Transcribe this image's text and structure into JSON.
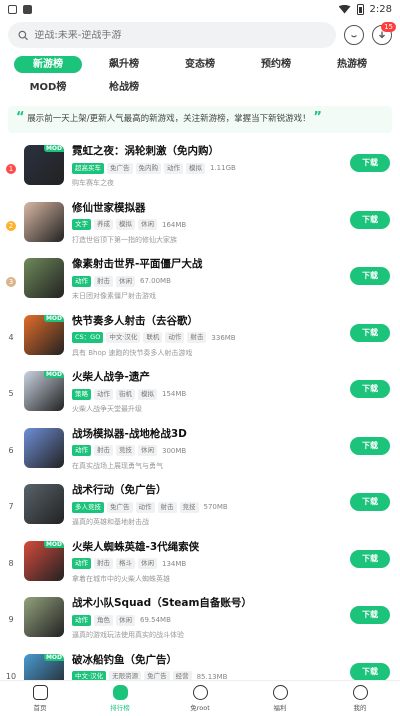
{
  "status": {
    "time": "2:28"
  },
  "search": {
    "placeholder": "逆战:未来-逆战手游",
    "mail_badge": "15"
  },
  "tabs": [
    {
      "label": "新游榜"
    },
    {
      "label": "飙升榜"
    },
    {
      "label": "变态榜"
    },
    {
      "label": "预约榜"
    },
    {
      "label": "热游榜"
    },
    {
      "label": "MOD榜"
    },
    {
      "label": "枪战榜"
    }
  ],
  "notice": {
    "text": "展示前一天上架/更新人气最高的新游戏，关注新游榜，掌握当下新锐游戏！"
  },
  "download_label": "下载",
  "games": [
    {
      "rank": "1",
      "title": "霓虹之夜：涡轮刺激（免内购）",
      "tags": [
        "超高买车",
        "免广告",
        "免内购",
        "动作",
        "模拟"
      ],
      "size": "1.11GB",
      "desc": "购车赛车之夜",
      "mod": true
    },
    {
      "rank": "2",
      "title": "修仙世家模拟器",
      "tags": [
        "文字",
        "养成",
        "模拟",
        "休闲"
      ],
      "size": "164MB",
      "desc": "打造世俗顶下第一指的修仙大家族",
      "mod": false
    },
    {
      "rank": "3",
      "title": "像素射击世界-平面僵尸大战",
      "tags": [
        "动作",
        "射击",
        "休闲"
      ],
      "size": "67.00MB",
      "desc": "末日团对像素僵尸射击游戏",
      "mod": false
    },
    {
      "rank": "4",
      "title": "快节奏多人射击（去谷歌）",
      "tags": [
        "CS：GO",
        "中文·汉化",
        "联机",
        "动作",
        "射击"
      ],
      "size": "336MB",
      "desc": "具有 Bhop 速跑的快节奏多人射击游戏",
      "mod": true
    },
    {
      "rank": "5",
      "title": "火柴人战争-遗产",
      "tags": [
        "策略",
        "动作",
        "街机",
        "模拟"
      ],
      "size": "154MB",
      "desc": "火柴人战争天堂最升级",
      "mod": true
    },
    {
      "rank": "6",
      "title": "战场模拟器-战地枪战3D",
      "tags": [
        "动作",
        "射击",
        "竞技",
        "休闲"
      ],
      "size": "300MB",
      "desc": "在真实战场上展现勇气与勇气",
      "mod": false
    },
    {
      "rank": "7",
      "title": "战术行动（免广告）",
      "tags": [
        "多人竞技",
        "免广告",
        "动作",
        "射击",
        "竞技"
      ],
      "size": "570MB",
      "desc": "逼真的英雄和基地射击战",
      "mod": false
    },
    {
      "rank": "8",
      "title": "火柴人蜘蛛英雄-3代绳索侠",
      "tags": [
        "动作",
        "射击",
        "格斗",
        "休闲"
      ],
      "size": "134MB",
      "desc": "拿着在城市中的火柴人蜘蛛英雄",
      "mod": true
    },
    {
      "rank": "9",
      "title": "战术小队Squad（Steam自备账号）",
      "tags": [
        "动作",
        "角色",
        "休闲"
      ],
      "size": "69.54MB",
      "desc": "逼真的游戏玩法使用真实的战斗体验",
      "mod": false
    },
    {
      "rank": "10",
      "title": "破冰船钓鱼（免广告）",
      "tags": [
        "中文·汉化",
        "无限资源",
        "免广告",
        "经营"
      ],
      "size": "85.13MB",
      "desc": "驾驶冰冻船打冰来钓鱼",
      "mod": true
    }
  ],
  "bottom_nav": [
    {
      "label": "首页",
      "icon": "home-icon"
    },
    {
      "label": "排行榜",
      "icon": "ranking-icon"
    },
    {
      "label": "免root",
      "icon": "compass-icon"
    },
    {
      "label": "福利",
      "icon": "gift-icon"
    },
    {
      "label": "我的",
      "icon": "profile-icon"
    }
  ]
}
